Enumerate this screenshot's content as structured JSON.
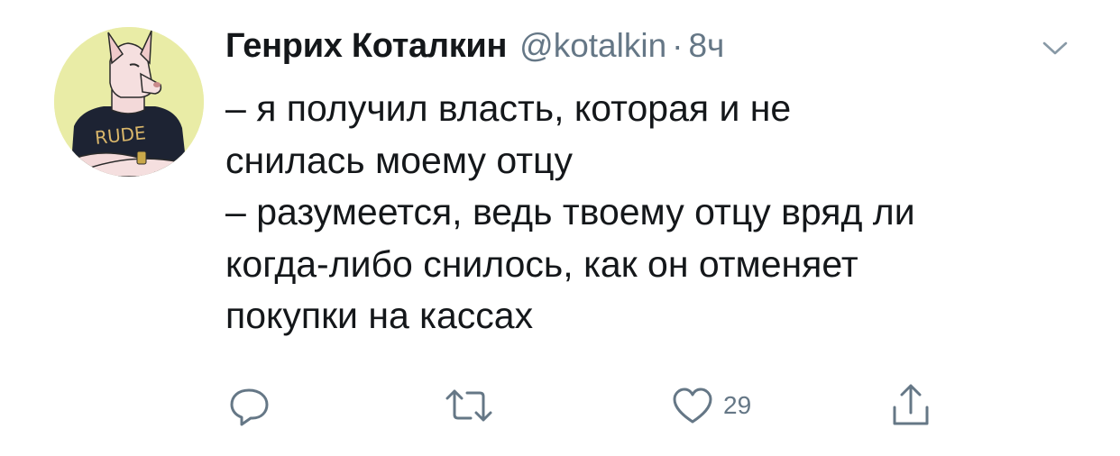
{
  "tweet": {
    "author_name": "Генрих Коталкин",
    "handle": "@kotalkin",
    "separator": "·",
    "time": "8ч",
    "avatar_print": "RUDE",
    "text_lines": [
      "– я получил власть, которая и не",
      "снилась моему отцу",
      "– разумеется, ведь твоему отцу вряд ли",
      "когда-либо снилось, как он отменяет",
      "покупки на кассах"
    ],
    "likes_count": "29"
  },
  "icons": {
    "reply": "reply-icon",
    "retweet": "retweet-icon",
    "like": "heart-icon",
    "share": "share-icon",
    "menu": "chevron-down-icon"
  },
  "colors": {
    "text": "#14171a",
    "secondary": "#657786",
    "icon": "#657786",
    "avatar_bg": "#e9eca6"
  }
}
